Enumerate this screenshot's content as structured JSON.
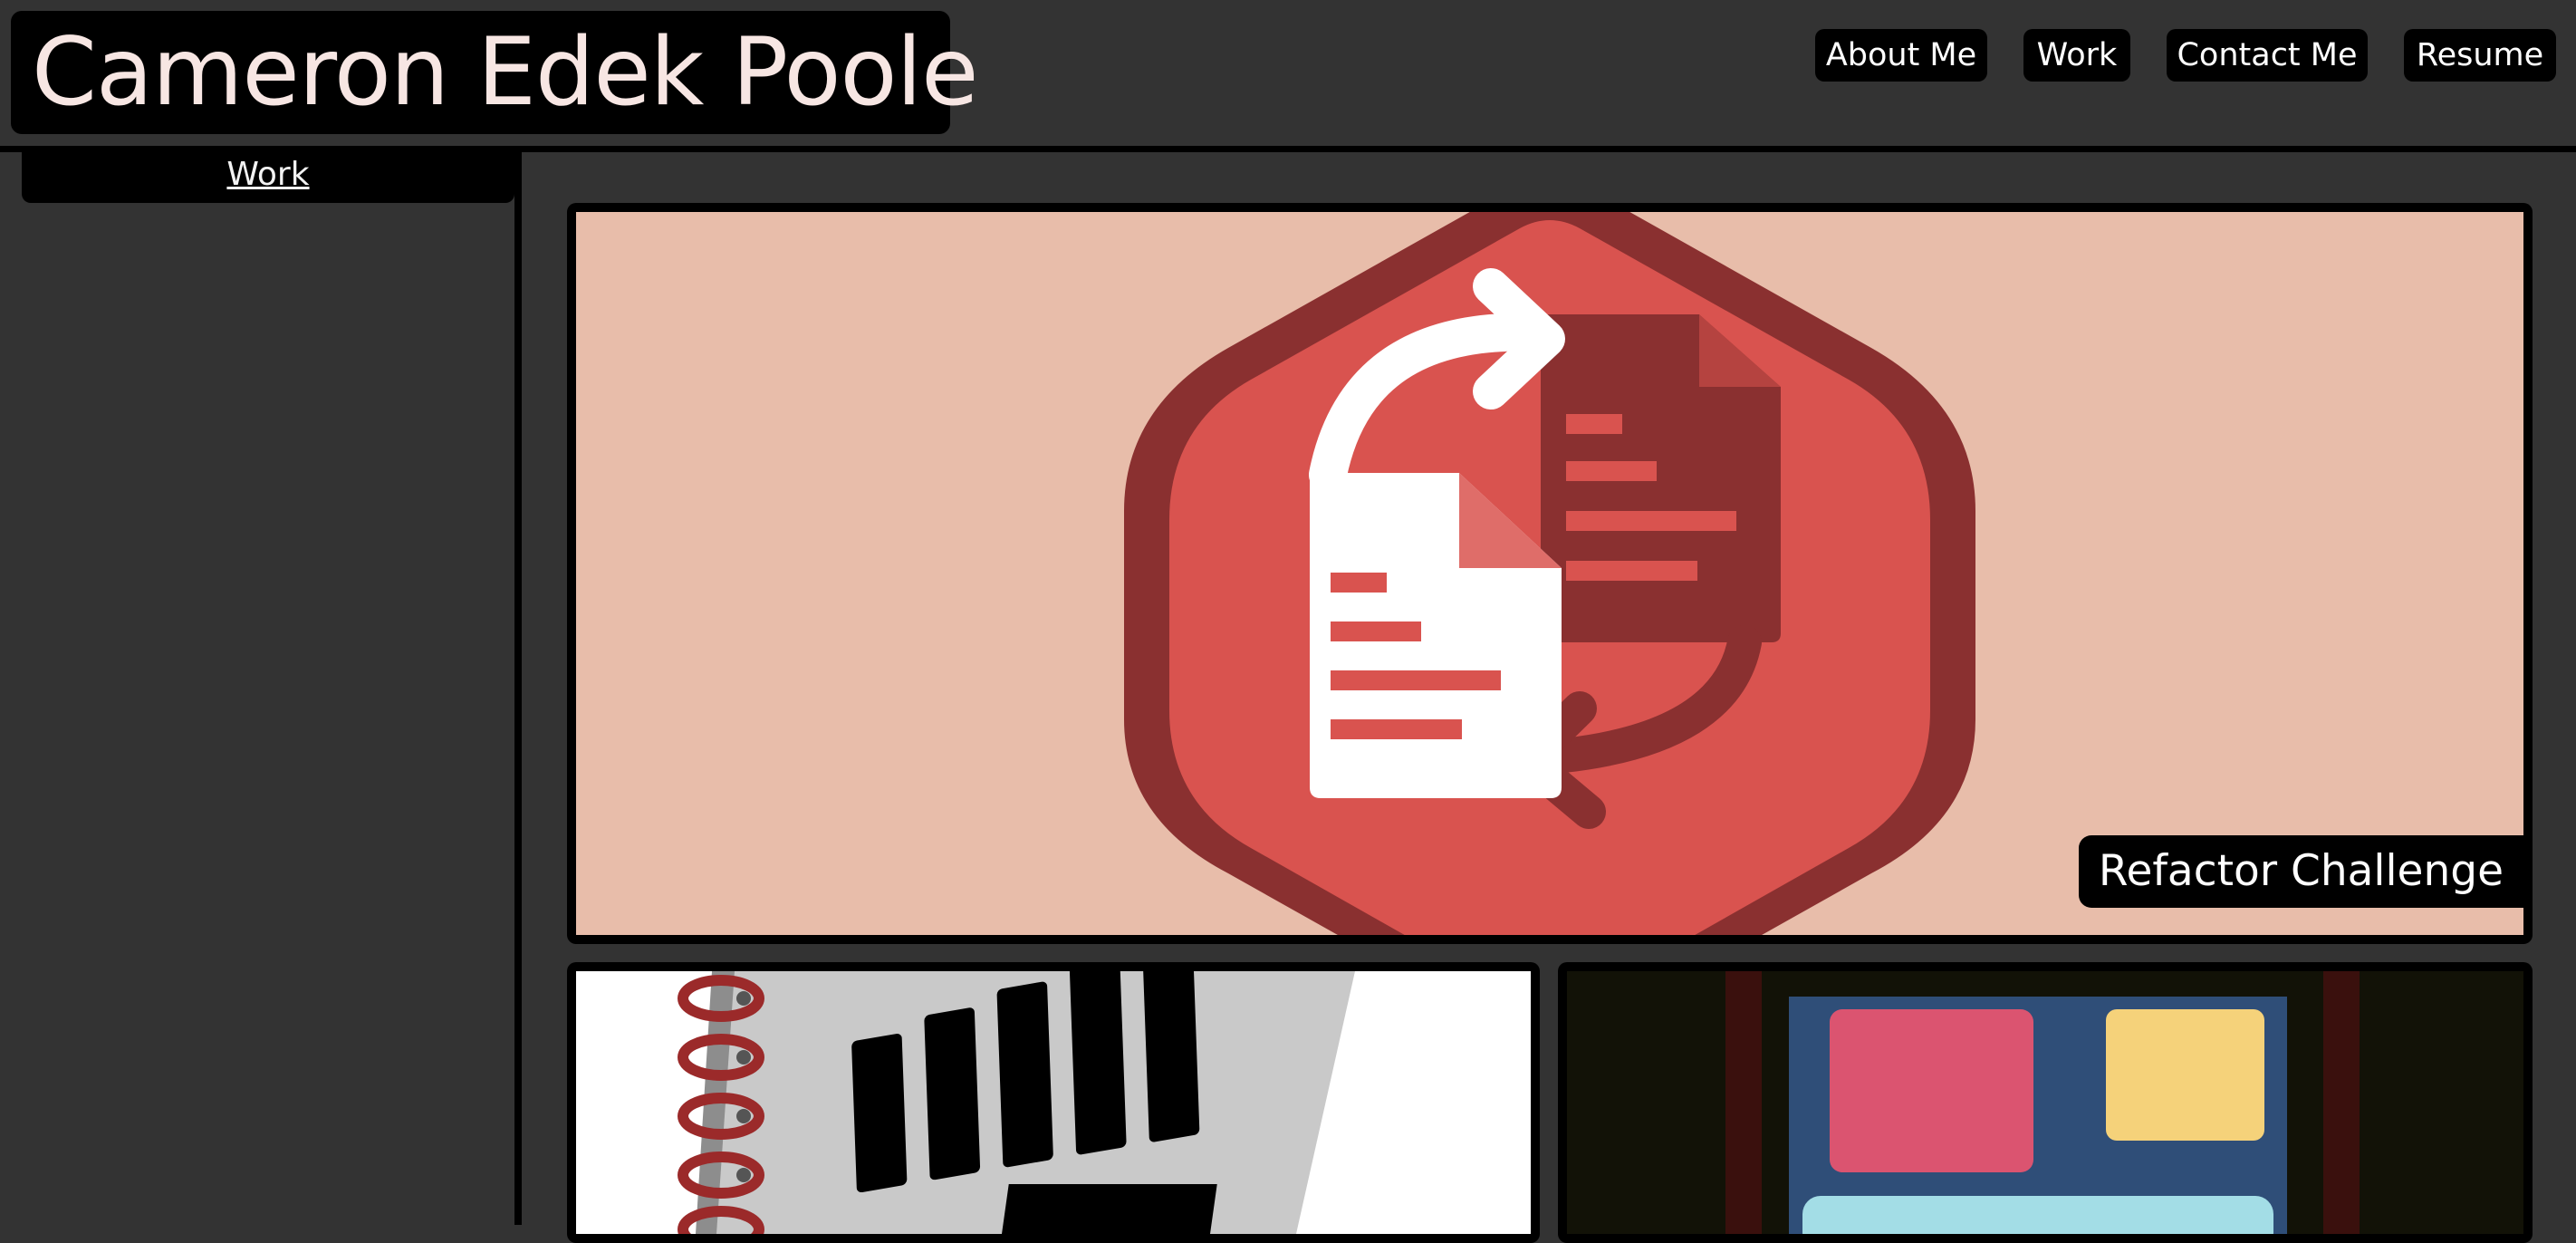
{
  "header": {
    "title": "Cameron Edek Poole",
    "nav": [
      {
        "label": "About Me"
      },
      {
        "label": "Work"
      },
      {
        "label": "Contact Me"
      },
      {
        "label": "Resume"
      }
    ]
  },
  "sidebar": {
    "active_tab": "Work"
  },
  "projects": [
    {
      "title": "Refactor Challenge",
      "image_icon": "refactor-document-swap-icon",
      "accent": "#d9534f"
    },
    {
      "image_icon": "study-guide-notebook-icon"
    },
    {
      "image_icon": "sticky-note-board-icon"
    }
  ],
  "colors": {
    "page_background": "#333333",
    "panel_black": "#000000",
    "title_text": "#f7e6e3",
    "refactor_bg": "#e8bdaa",
    "refactor_red": "#d9534f",
    "refactor_dark": "#8a3030"
  }
}
